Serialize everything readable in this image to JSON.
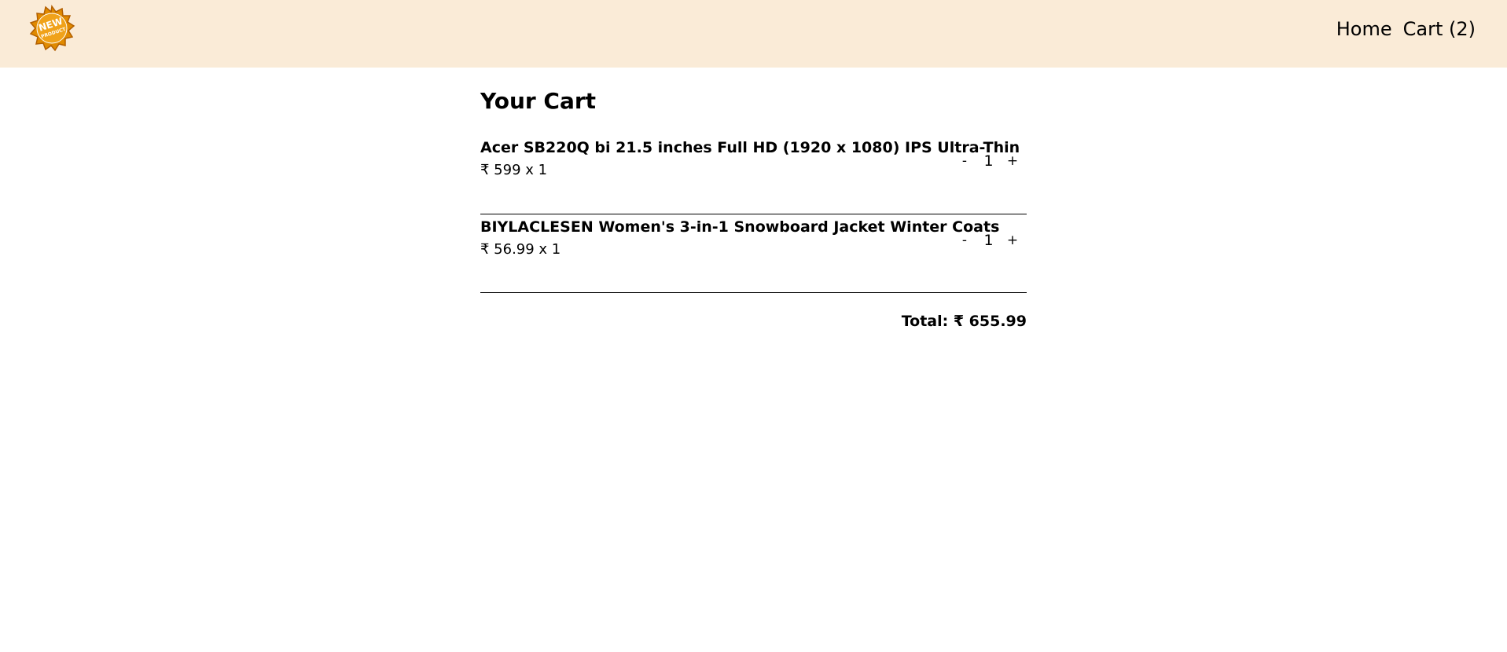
{
  "header": {
    "logo_icon": "new-product-badge-icon",
    "logo_text_line1": "NEW",
    "logo_text_line2": "PRODUCT",
    "logo_color": "#e08a00",
    "background": "#faebd7",
    "nav": {
      "home_label": "Home",
      "cart_label": "Cart (2)"
    }
  },
  "main": {
    "title": "Your Cart",
    "items": [
      {
        "title": "Acer SB220Q bi 21.5 inches Full HD (1920 x 1080) IPS Ultra-Thin",
        "price_line": "₹ 599 x 1",
        "decrement_label": "-",
        "quantity": "1",
        "increment_label": "+"
      },
      {
        "title": "BIYLACLESEN Women's 3-in-1 Snowboard Jacket Winter Coats",
        "price_line": "₹ 56.99 x 1",
        "decrement_label": "-",
        "quantity": "1",
        "increment_label": "+"
      }
    ],
    "total": "Total: ₹ 655.99"
  }
}
